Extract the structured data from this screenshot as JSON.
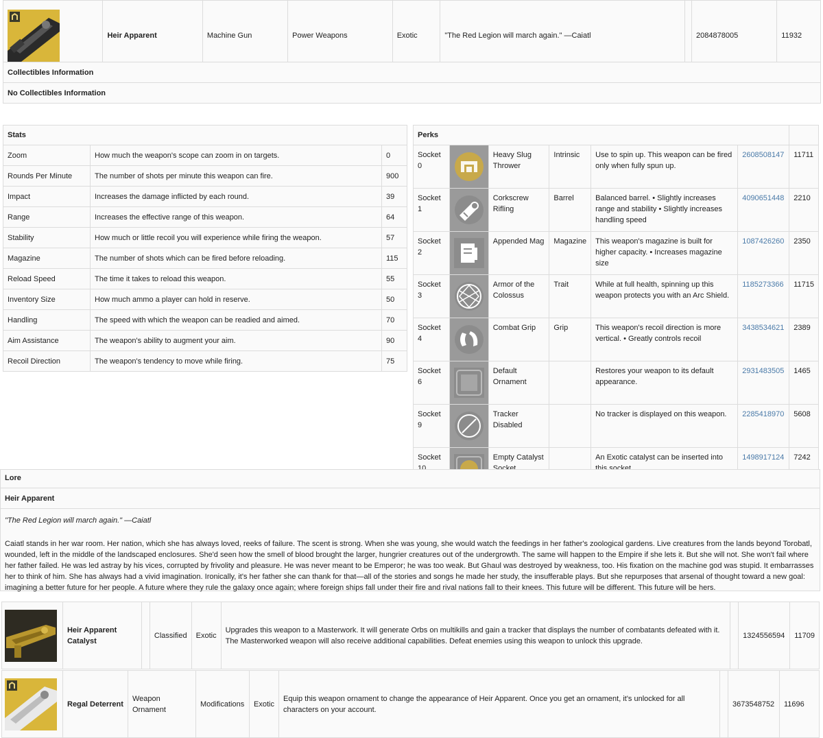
{
  "item": {
    "name": "Heir Apparent",
    "weapon_type": "Machine Gun",
    "slot": "Power Weapons",
    "tier": "Exotic",
    "flavor": "\"The Red Legion will march again.\" —Caiatl",
    "hash": "2084878005",
    "index": "11932"
  },
  "collectibles": {
    "title": "Collectibles Information",
    "none": "No Collectibles Information"
  },
  "stats": {
    "title": "Stats",
    "rows": [
      {
        "name": "Zoom",
        "desc": "How much the weapon's scope can zoom in on targets.",
        "value": "0"
      },
      {
        "name": "Rounds Per Minute",
        "desc": "The number of shots per minute this weapon can fire.",
        "value": "900"
      },
      {
        "name": "Impact",
        "desc": "Increases the damage inflicted by each round.",
        "value": "39"
      },
      {
        "name": "Range",
        "desc": "Increases the effective range of this weapon.",
        "value": "64"
      },
      {
        "name": "Stability",
        "desc": "How much or little recoil you will experience while firing the weapon.",
        "value": "57"
      },
      {
        "name": "Magazine",
        "desc": "The number of shots which can be fired before reloading.",
        "value": "115"
      },
      {
        "name": "Reload Speed",
        "desc": "The time it takes to reload this weapon.",
        "value": "55"
      },
      {
        "name": "Inventory Size",
        "desc": "How much ammo a player can hold in reserve.",
        "value": "50"
      },
      {
        "name": "Handling",
        "desc": "The speed with which the weapon can be readied and aimed.",
        "value": "70"
      },
      {
        "name": "Aim Assistance",
        "desc": "The weapon's ability to augment your aim.",
        "value": "90"
      },
      {
        "name": "Recoil Direction",
        "desc": "The weapon's tendency to move while firing.",
        "value": "75"
      }
    ]
  },
  "perks": {
    "title": "Perks",
    "rows": [
      {
        "socket": "Socket 0",
        "icon": "heavy-slug-thrower-icon",
        "color": "#c8a94a",
        "name": "Heavy Slug Thrower",
        "type": "Intrinsic",
        "desc": "Use to spin up. This weapon can be fired only when fully spun up.",
        "hash": "2608508147",
        "index": "11711"
      },
      {
        "socket": "Socket 1",
        "icon": "corkscrew-rifling-icon",
        "color": "#8c8c8c",
        "name": "Corkscrew Rifling",
        "type": "Barrel",
        "desc": "Balanced barrel. • Slightly increases range and stability • Slightly increases handling speed",
        "hash": "4090651448",
        "index": "2210"
      },
      {
        "socket": "Socket 2",
        "icon": "appended-mag-icon",
        "color": "#8c8c8c",
        "name": "Appended Mag",
        "type": "Magazine",
        "desc": "This weapon's magazine is built for higher capacity. • Increases magazine size",
        "hash": "1087426260",
        "index": "2350"
      },
      {
        "socket": "Socket 3",
        "icon": "armor-of-the-colossus-icon",
        "color": "#8c8c8c",
        "name": "Armor of the Colossus",
        "type": "Trait",
        "desc": "While at full health, spinning up this weapon protects you with an Arc Shield.",
        "hash": "1185273366",
        "index": "11715"
      },
      {
        "socket": "Socket 4",
        "icon": "combat-grip-icon",
        "color": "#8c8c8c",
        "name": "Combat Grip",
        "type": "Grip",
        "desc": "This weapon's recoil direction is more vertical. • Greatly controls recoil",
        "hash": "3438534621",
        "index": "2389"
      },
      {
        "socket": "Socket 6",
        "icon": "default-ornament-icon",
        "color": "#8c8c8c",
        "name": "Default Ornament",
        "type": "",
        "desc": "Restores your weapon to its default appearance.",
        "hash": "2931483505",
        "index": "1465"
      },
      {
        "socket": "Socket 9",
        "icon": "tracker-disabled-icon",
        "color": "#8c8c8c",
        "name": "Tracker Disabled",
        "type": "",
        "desc": "No tracker is displayed on this weapon.",
        "hash": "2285418970",
        "index": "5608"
      },
      {
        "socket": "Socket 10",
        "icon": "empty-catalyst-socket-icon",
        "color": "#c8a94a",
        "name": "Empty Catalyst Socket",
        "type": "",
        "desc": "An Exotic catalyst can be inserted into this socket.",
        "hash": "1498917124",
        "index": "7242"
      }
    ]
  },
  "lore": {
    "title": "Lore",
    "subtitle": "Heir Apparent",
    "quote": "\"The Red Legion will march again.\" —Caiatl",
    "body": "Caiatl stands in her war room. Her nation, which she has always loved, reeks of failure. The scent is strong. When she was young, she would watch the feedings in her father's zoological gardens. Live creatures from the lands beyond Torobatl, wounded, left in the middle of the landscaped enclosures. She'd seen how the smell of blood brought the larger, hungrier creatures out of the undergrowth. The same will happen to the Empire if she lets it. But she will not. She won't fail where her father failed. He was led astray by his vices, corrupted by frivolity and pleasure. He was never meant to be Emperor; he was too weak. But Ghaul was destroyed by weakness, too. His fixation on the machine god was stupid. It embarrasses her to think of him. She has always had a vivid imagination. Ironically, it's her father she can thank for that—all of the stories and songs he made her study, the insufferable plays. But she repurposes that arsenal of thought toward a new goal: imagining a better future for her people. A future where they rule the galaxy once again; where foreign ships fall under their fire and rival nations fall to their knees. This future will be different. This future will be hers."
  },
  "catalyst": {
    "name": "Heir Apparent Catalyst",
    "type": "Classified",
    "tier": "Exotic",
    "desc": "Upgrades this weapon to a Masterwork. It will generate Orbs on multikills and gain a tracker that displays the number of combatants defeated with it. The Masterworked weapon will also receive additional capabilities. Defeat enemies using this weapon to unlock this upgrade.",
    "hash": "1324556594",
    "index": "11709"
  },
  "ornament": {
    "name": "Regal Deterrent",
    "type": "Weapon Ornament",
    "category": "Modifications",
    "tier": "Exotic",
    "desc": "Equip this weapon ornament to change the appearance of Heir Apparent. Once you get an ornament, it's unlocked for all characters on your account.",
    "hash": "3673548752",
    "index": "11696"
  },
  "colors": {
    "link": "#4a7aa8",
    "exotic_gold": "#d9b63a",
    "icon_bg": "#9a9a9a"
  }
}
